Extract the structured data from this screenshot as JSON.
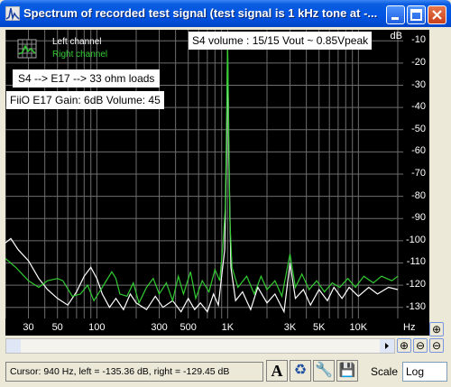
{
  "window": {
    "title": "Spectrum of recorded test signal (test signal is 1 kHz tone at -..."
  },
  "legend": {
    "left_label": "Left channel",
    "right_label": "Right channel"
  },
  "overlays": {
    "volume_text": "S4 volume :   15/15    Vout ~ 0.85Vpeak",
    "load_text": "S4 -->  E17 --> 33 ohm loads",
    "device_text": "FiiO E17   Gain: 6dB   Volume: 45"
  },
  "colors": {
    "plot_bg": "#000000",
    "grid": "#6e6e6e",
    "left_channel": "#ffffff",
    "right_channel": "#33cc33",
    "titlebar": "#0054e3"
  },
  "chart_data": {
    "type": "line",
    "xscale": "log",
    "xlim": [
      20,
      22000
    ],
    "ylim": [
      -135,
      -5
    ],
    "xlabel": "Hz",
    "ylabel": "dB",
    "x_ticks": [
      {
        "label": "30",
        "value": 30
      },
      {
        "label": "50",
        "value": 50
      },
      {
        "label": "100",
        "value": 100
      },
      {
        "label": "300",
        "value": 300
      },
      {
        "label": "500",
        "value": 500
      },
      {
        "label": "1K",
        "value": 1000
      },
      {
        "label": "3K",
        "value": 3000
      },
      {
        "label": "5K",
        "value": 5000
      },
      {
        "label": "10K",
        "value": 10000
      }
    ],
    "y_ticks": [
      "-10",
      "-20",
      "-30",
      "-40",
      "-50",
      "-60",
      "-70",
      "-80",
      "-90",
      "-100",
      "-110",
      "-120",
      "-130"
    ],
    "series": [
      {
        "name": "Left channel",
        "color": "#ffffff",
        "points": [
          [
            20,
            -101
          ],
          [
            22,
            -99
          ],
          [
            25,
            -104
          ],
          [
            30,
            -109
          ],
          [
            36,
            -117
          ],
          [
            42,
            -122
          ],
          [
            50,
            -126
          ],
          [
            60,
            -129
          ],
          [
            70,
            -123
          ],
          [
            80,
            -116
          ],
          [
            90,
            -112
          ],
          [
            100,
            -117
          ],
          [
            110,
            -124
          ],
          [
            125,
            -130
          ],
          [
            140,
            -126
          ],
          [
            160,
            -131
          ],
          [
            180,
            -124
          ],
          [
            200,
            -128
          ],
          [
            240,
            -131
          ],
          [
            280,
            -125
          ],
          [
            320,
            -130
          ],
          [
            380,
            -127
          ],
          [
            440,
            -132
          ],
          [
            500,
            -126
          ],
          [
            560,
            -131
          ],
          [
            620,
            -128
          ],
          [
            700,
            -132
          ],
          [
            780,
            -124
          ],
          [
            850,
            -129
          ],
          [
            900,
            -116
          ],
          [
            950,
            -104
          ],
          [
            980,
            -60
          ],
          [
            1000,
            -12
          ],
          [
            1020,
            -60
          ],
          [
            1060,
            -112
          ],
          [
            1150,
            -127
          ],
          [
            1300,
            -123
          ],
          [
            1500,
            -131
          ],
          [
            1700,
            -121
          ],
          [
            2000,
            -128
          ],
          [
            2300,
            -124
          ],
          [
            2700,
            -132
          ],
          [
            3000,
            -110
          ],
          [
            3300,
            -126
          ],
          [
            3800,
            -122
          ],
          [
            4300,
            -129
          ],
          [
            5000,
            -122
          ],
          [
            5800,
            -127
          ],
          [
            6500,
            -121
          ],
          [
            7500,
            -126
          ],
          [
            8500,
            -121
          ],
          [
            10000,
            -125
          ],
          [
            12000,
            -121
          ],
          [
            14000,
            -124
          ],
          [
            17000,
            -121
          ],
          [
            20000,
            -122
          ]
        ]
      },
      {
        "name": "Right channel",
        "color": "#33cc33",
        "points": [
          [
            20,
            -108
          ],
          [
            24,
            -112
          ],
          [
            30,
            -118
          ],
          [
            36,
            -121
          ],
          [
            42,
            -118
          ],
          [
            50,
            -117
          ],
          [
            55,
            -118
          ],
          [
            65,
            -125
          ],
          [
            75,
            -124
          ],
          [
            85,
            -120
          ],
          [
            95,
            -127
          ],
          [
            110,
            -121
          ],
          [
            130,
            -114
          ],
          [
            140,
            -117
          ],
          [
            150,
            -124
          ],
          [
            170,
            -125
          ],
          [
            190,
            -119
          ],
          [
            210,
            -128
          ],
          [
            240,
            -121
          ],
          [
            270,
            -117
          ],
          [
            300,
            -124
          ],
          [
            340,
            -119
          ],
          [
            380,
            -127
          ],
          [
            420,
            -116
          ],
          [
            460,
            -124
          ],
          [
            520,
            -114
          ],
          [
            570,
            -126
          ],
          [
            640,
            -118
          ],
          [
            720,
            -123
          ],
          [
            800,
            -113
          ],
          [
            870,
            -118
          ],
          [
            920,
            -102
          ],
          [
            960,
            -85
          ],
          [
            985,
            -40
          ],
          [
            1000,
            -9
          ],
          [
            1015,
            -40
          ],
          [
            1040,
            -90
          ],
          [
            1080,
            -112
          ],
          [
            1200,
            -121
          ],
          [
            1400,
            -116
          ],
          [
            1600,
            -124
          ],
          [
            1800,
            -116
          ],
          [
            2000,
            -122
          ],
          [
            2300,
            -118
          ],
          [
            2600,
            -125
          ],
          [
            3000,
            -106
          ],
          [
            3300,
            -121
          ],
          [
            3700,
            -115
          ],
          [
            4200,
            -122
          ],
          [
            4800,
            -118
          ],
          [
            5500,
            -123
          ],
          [
            6300,
            -119
          ],
          [
            7200,
            -121
          ],
          [
            8300,
            -117
          ],
          [
            9500,
            -121
          ],
          [
            11000,
            -116
          ],
          [
            13000,
            -119
          ],
          [
            15000,
            -116
          ],
          [
            18000,
            -118
          ],
          [
            20000,
            -116
          ]
        ]
      }
    ]
  },
  "zoom_buttons": {
    "zoom_in_v": "⊕",
    "zoom_in_h": "⊕",
    "zoom_out_h": "⊖",
    "zoom_out_v": "⊖",
    "scroll_left": "◂",
    "scroll_right": "▸"
  },
  "status": {
    "cursor_text": "Cursor:  940 Hz,  left = -135.36 dB,  right = -129.45 dB",
    "font_button": "A",
    "recycle_icon": "♻",
    "tools_icon": "🔧",
    "save_icon": "💾",
    "scale_label": "Scale",
    "scale_value": "Log"
  }
}
